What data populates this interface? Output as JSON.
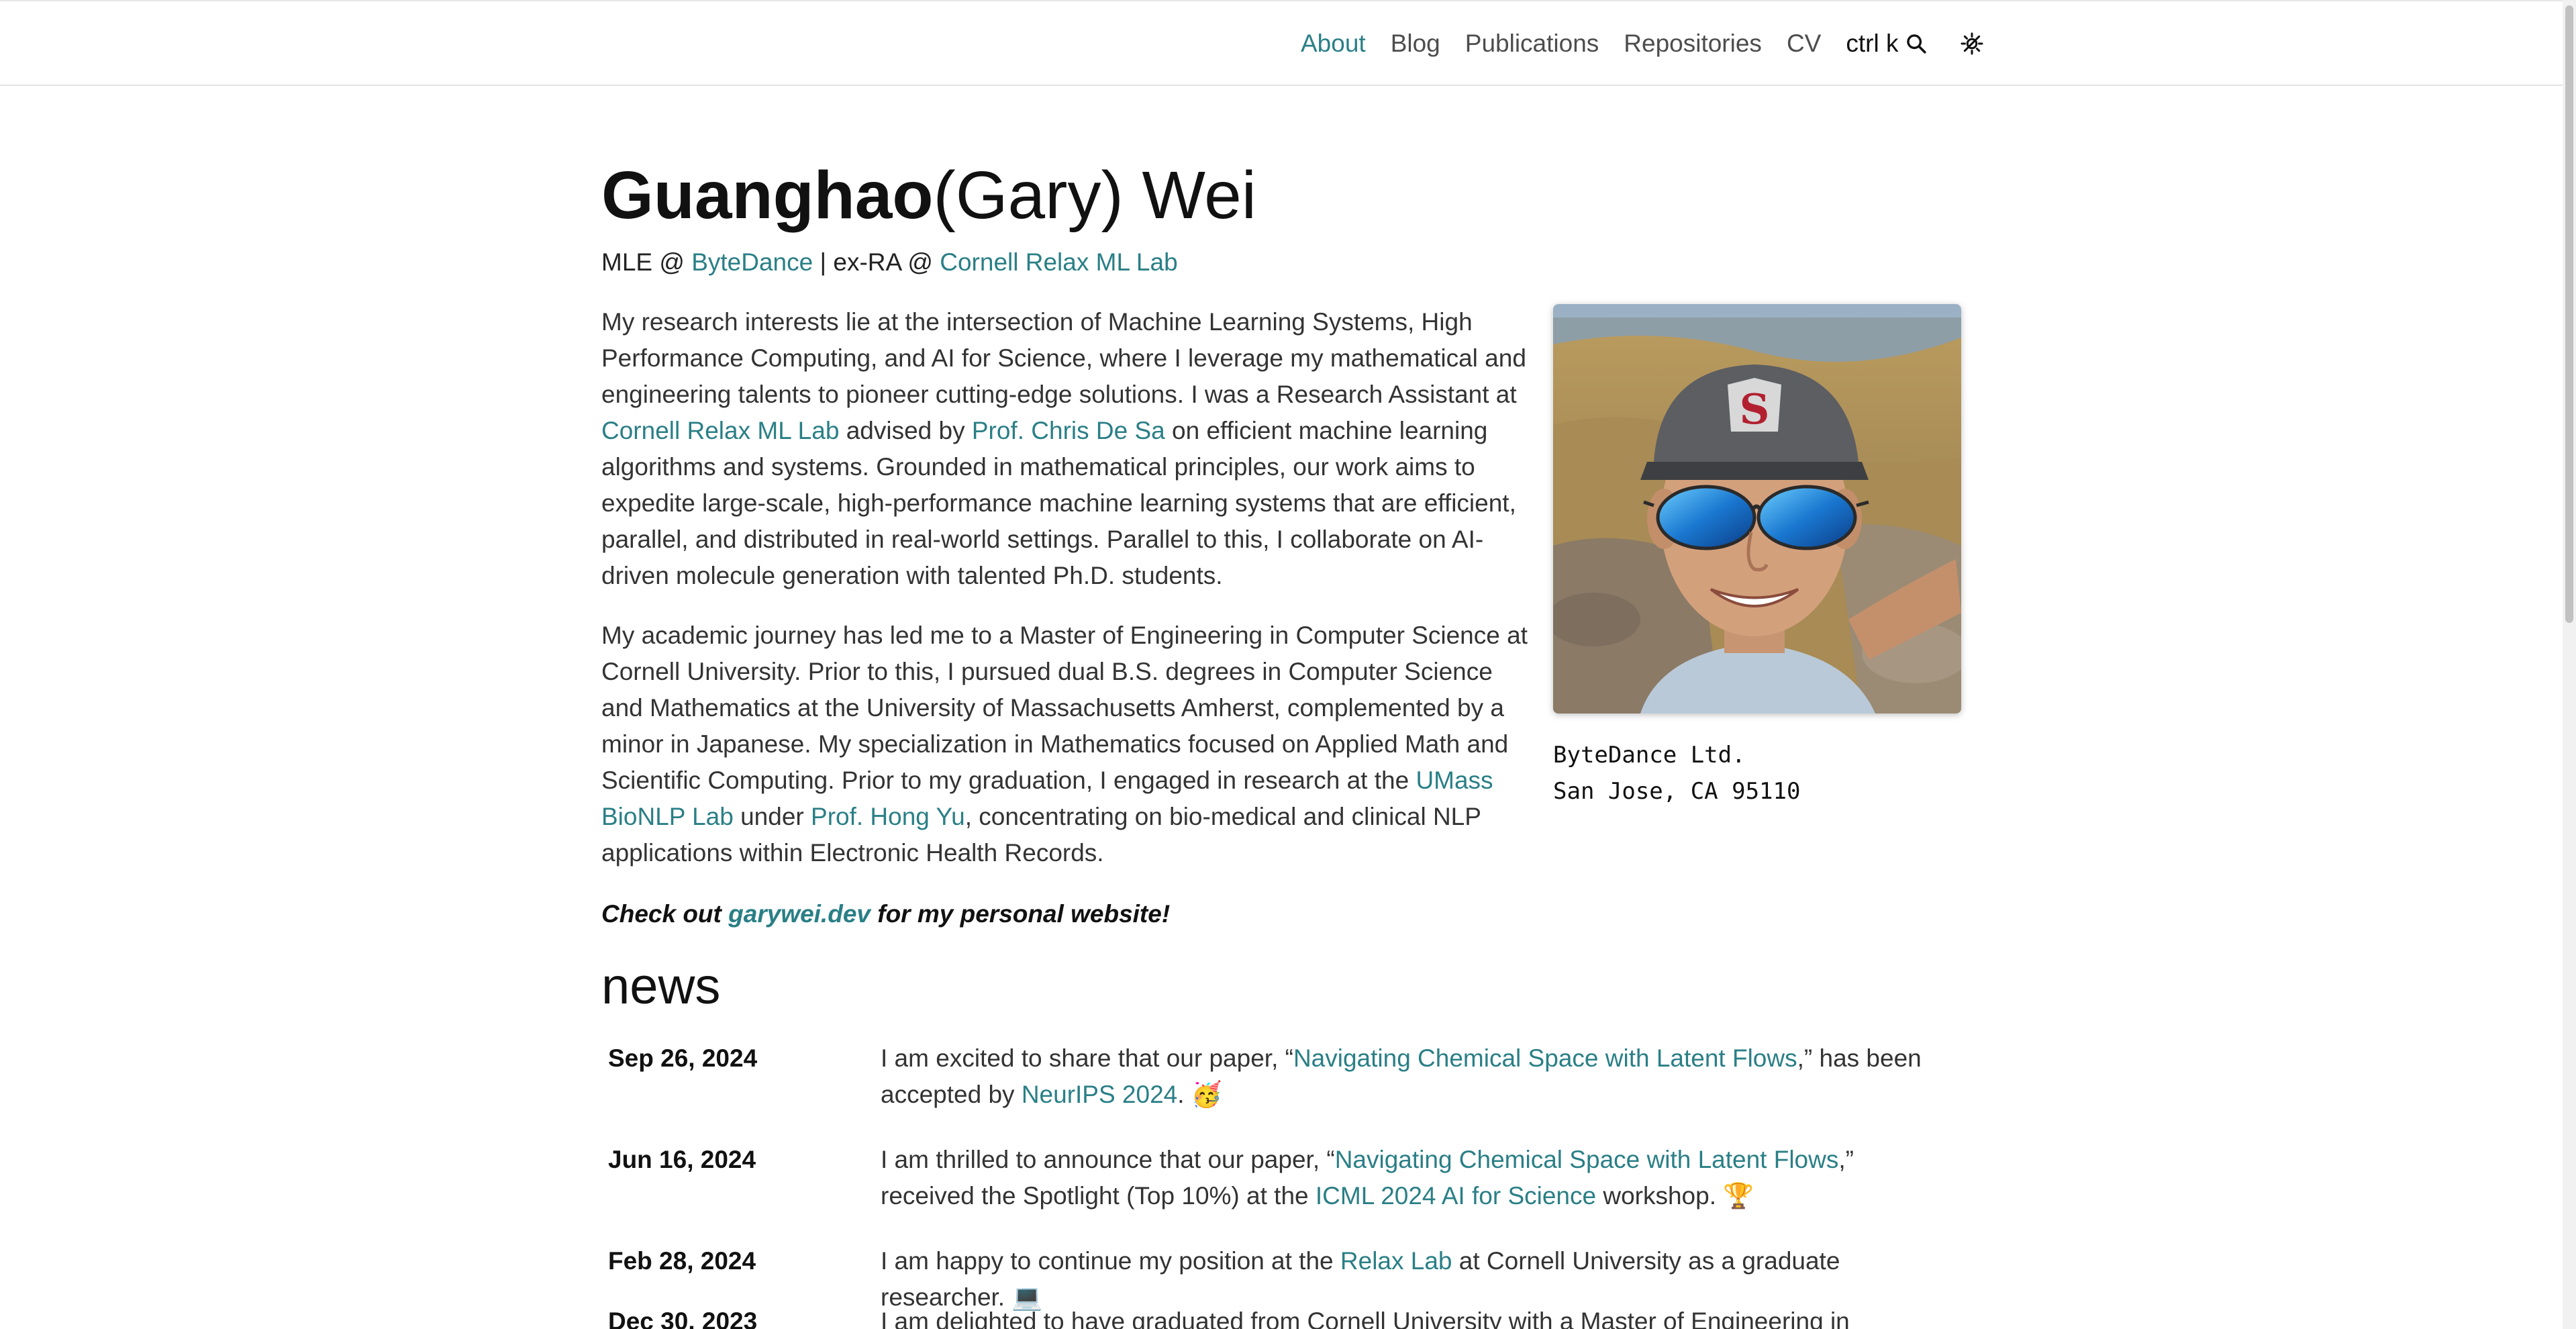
{
  "nav": {
    "items": [
      {
        "label": "About",
        "active": true
      },
      {
        "label": "Blog",
        "active": false
      },
      {
        "label": "Publications",
        "active": false
      },
      {
        "label": "Repositories",
        "active": false
      },
      {
        "label": "CV",
        "active": false
      }
    ],
    "search_label": "ctrl k",
    "search_icon": "search-icon",
    "theme_icon": "theme-toggle-icon"
  },
  "profile": {
    "name_bold": "Guanghao",
    "name_rest": "(Gary) Wei",
    "subtitle": {
      "prefix": "MLE @ ",
      "company": "ByteDance",
      "middle": " | ex-RA @ ",
      "lab": "Cornell Relax ML Lab"
    },
    "address_line1": "ByteDance Ltd.",
    "address_line2": "San Jose, CA 95110"
  },
  "bio": {
    "p1_a": "My research interests lie at the intersection of Machine Learning Systems, High Performance Computing, and AI for Science, where I leverage my mathematical and engineering talents to pioneer cutting-edge solutions. I was a Research Assistant at ",
    "p1_link1": "Cornell Relax ML Lab",
    "p1_b": " advised by ",
    "p1_link2": "Prof. Chris De Sa",
    "p1_c": " on efficient machine learning algorithms and systems. Grounded in mathematical principles, our work aims to expedite large-scale, high-performance machine learning systems that are efficient, parallel, and distributed in real-world settings. Parallel to this, I collaborate on AI-driven molecule generation with talented Ph.D. students.",
    "p2_a": "My academic journey has led me to a Master of Engineering in Computer Science at Cornell University. Prior to this, I pursued dual B.S. degrees in Computer Science and Mathematics at the University of Massachusetts Amherst, complemented by a minor in Japanese. My specialization in Mathematics focused on Applied Math and Scientific Computing. Prior to my graduation, I engaged in research at the ",
    "p2_link1": "UMass BioNLP Lab",
    "p2_b": " under ",
    "p2_link2": "Prof. Hong Yu",
    "p2_c": ", concentrating on bio-medical and clinical NLP applications within Electronic Health Records.",
    "callout_a": "Check out ",
    "callout_link": "garywei.dev",
    "callout_b": " for my personal website!"
  },
  "news": {
    "heading": "news",
    "items": [
      {
        "date": "Sep 26, 2024",
        "a": "I am excited to share that our paper, “",
        "link1": "Navigating Chemical Space with Latent Flows",
        "b": ",” has been accepted by ",
        "link2": "NeurIPS 2024",
        "c": ". 🥳"
      },
      {
        "date": "Jun 16, 2024",
        "a": "I am thrilled to announce that our paper, “",
        "link1": "Navigating Chemical Space with Latent Flows",
        "b": ",” received the Spotlight (Top 10%) at the ",
        "link2": "ICML 2024 AI for Science",
        "c": " workshop. 🏆"
      },
      {
        "date": "Feb 28, 2024",
        "a": "I am happy to continue my position at the ",
        "link1": "Relax Lab",
        "b": " at Cornell University as a graduate researcher. 💻"
      },
      {
        "date": "Dec 30, 2023",
        "a": "I am delighted to have graduated from Cornell University with a Master of Engineering in Computer"
      }
    ]
  },
  "colors": {
    "accent": "#2a7f86",
    "text": "#333333"
  }
}
